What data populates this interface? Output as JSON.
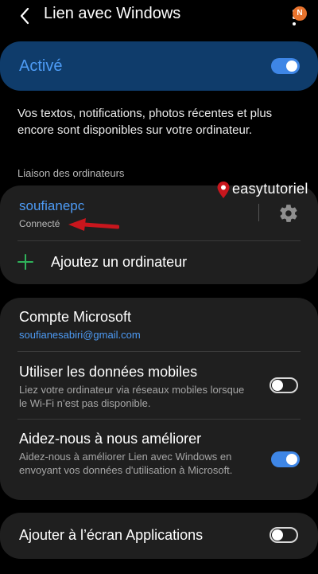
{
  "header": {
    "title": "Lien avec Windows",
    "notification_badge": "N"
  },
  "master_switch": {
    "label": "Activé",
    "on": true
  },
  "description": "Vos textos, notifications, photos récentes et plus encore sont disponibles sur votre ordinateur.",
  "linked_section": {
    "label": "Liaison des ordinateurs",
    "computer": {
      "name": "soufianepc",
      "status": "Connecté"
    },
    "add_label": "Ajoutez un ordinateur"
  },
  "watermark": {
    "text": "easytutoriel"
  },
  "settings": {
    "account": {
      "title": "Compte Microsoft",
      "email": "soufianesabiri@gmail.com"
    },
    "mobile_data": {
      "title": "Utiliser les données mobiles",
      "subtitle": "Liez votre ordinateur via réseaux mobiles lorsque le Wi-Fi n’est pas disponible.",
      "on": false
    },
    "improve": {
      "title": "Aidez-nous à nous améliorer",
      "subtitle": "Aidez-nous à améliorer Lien avec Windows en envoyant vos données d'utilisation à Microsoft.",
      "on": true
    }
  },
  "apps_screen": {
    "title": "Ajouter à l’écran Applications",
    "on": false
  },
  "colors": {
    "accent": "#4d9bf5",
    "toggle_on": "#3e86e6",
    "card_bg": "#1f1f1f",
    "master_bg": "#0f3c6b",
    "plus_green": "#2fb35a",
    "arrow_red": "#c8161d",
    "badge_orange": "#e8732d"
  }
}
